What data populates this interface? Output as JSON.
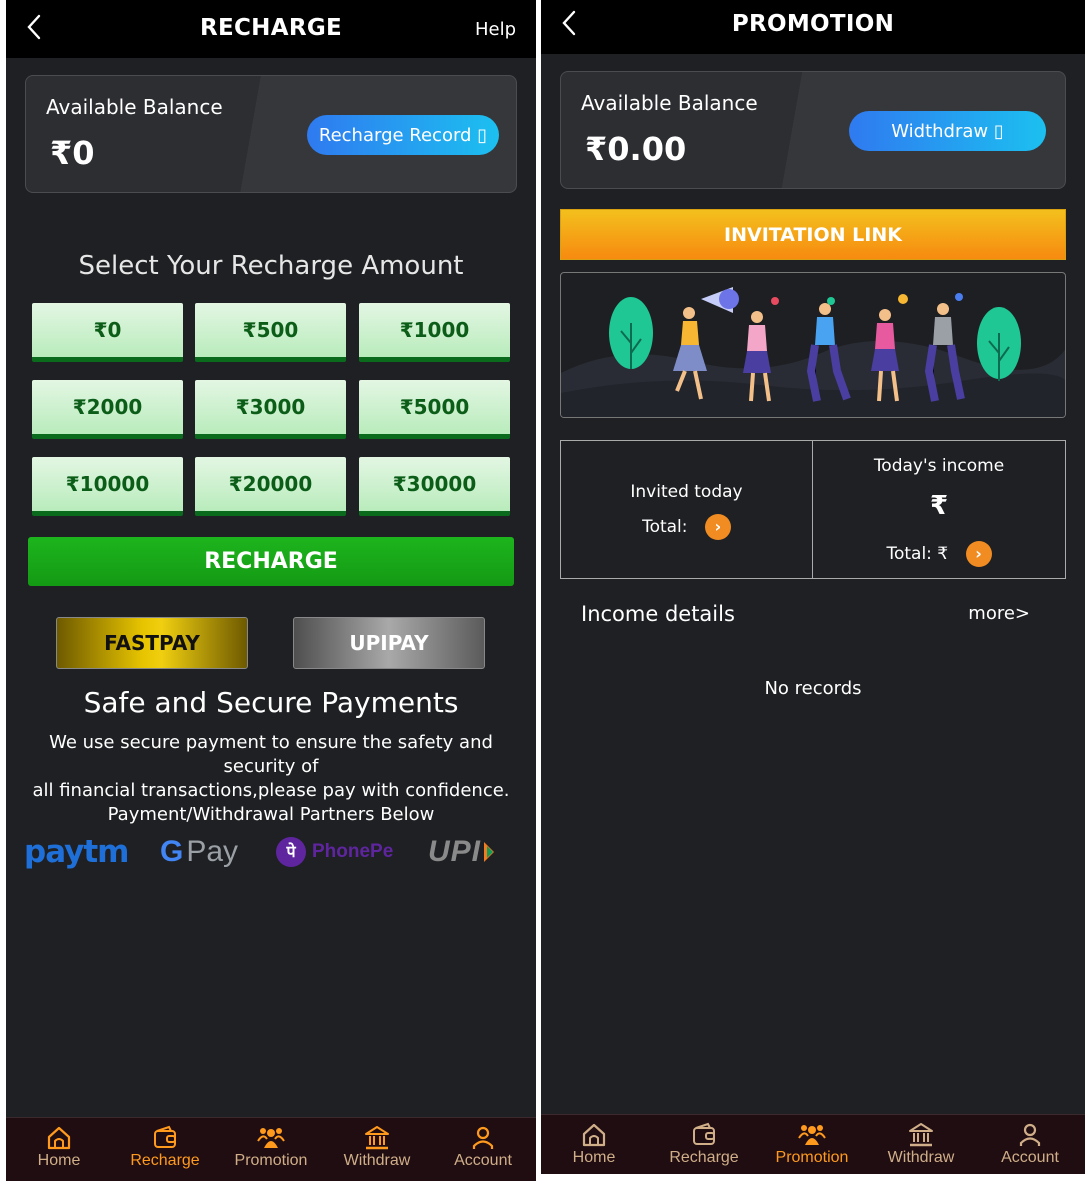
{
  "recharge_screen": {
    "title": "RECHARGE",
    "help": "Help",
    "balance": {
      "label": "Available Balance",
      "value": "₹0",
      "record_button": "Recharge Record ▯"
    },
    "select_title": "Select Your Recharge Amount",
    "amounts": [
      "₹0",
      "₹500",
      "₹1000",
      "₹2000",
      "₹3000",
      "₹5000",
      "₹10000",
      "₹20000",
      "₹30000"
    ],
    "recharge_button": "RECHARGE",
    "payment_options": [
      "FASTPAY",
      "UPIPAY"
    ],
    "secure_title": "Safe and Secure Payments",
    "secure_lines": [
      "We use secure payment to ensure the safety and security of",
      "all financial transactions,please pay with confidence.",
      "Payment/Withdrawal Partners Below"
    ],
    "partners": {
      "paytm": "paytm",
      "gpay_g": "G",
      "gpay_text": "Pay",
      "phonepe_glyph": "पे",
      "phonepe_text": "PhonePe",
      "upi": "UPI"
    }
  },
  "promotion_screen": {
    "title": "PROMOTION",
    "balance": {
      "label": "Available Balance",
      "value": "₹0.00",
      "withdraw_button": "Widthdraw ▯"
    },
    "invitation_link": "INVITATION LINK",
    "invited_today": "Invited today",
    "invited_total": "Total:",
    "todays_income": "Today's income",
    "income_symbol": "₹",
    "income_total": "Total: ₹",
    "arrow": "›",
    "income_details": "Income details",
    "more": "more>",
    "no_records": "No records"
  },
  "nav": {
    "items": [
      "Home",
      "Recharge",
      "Promotion",
      "Withdraw",
      "Account"
    ],
    "left_active": "Recharge",
    "right_active": "Promotion"
  },
  "colors": {
    "background": "#1e2023",
    "accent_green": "#149a14",
    "accent_orange": "#f78a10",
    "nav_bg": "#200d12",
    "nav_active": "#ff9a1d",
    "nav_inactive": "#cfae88"
  }
}
